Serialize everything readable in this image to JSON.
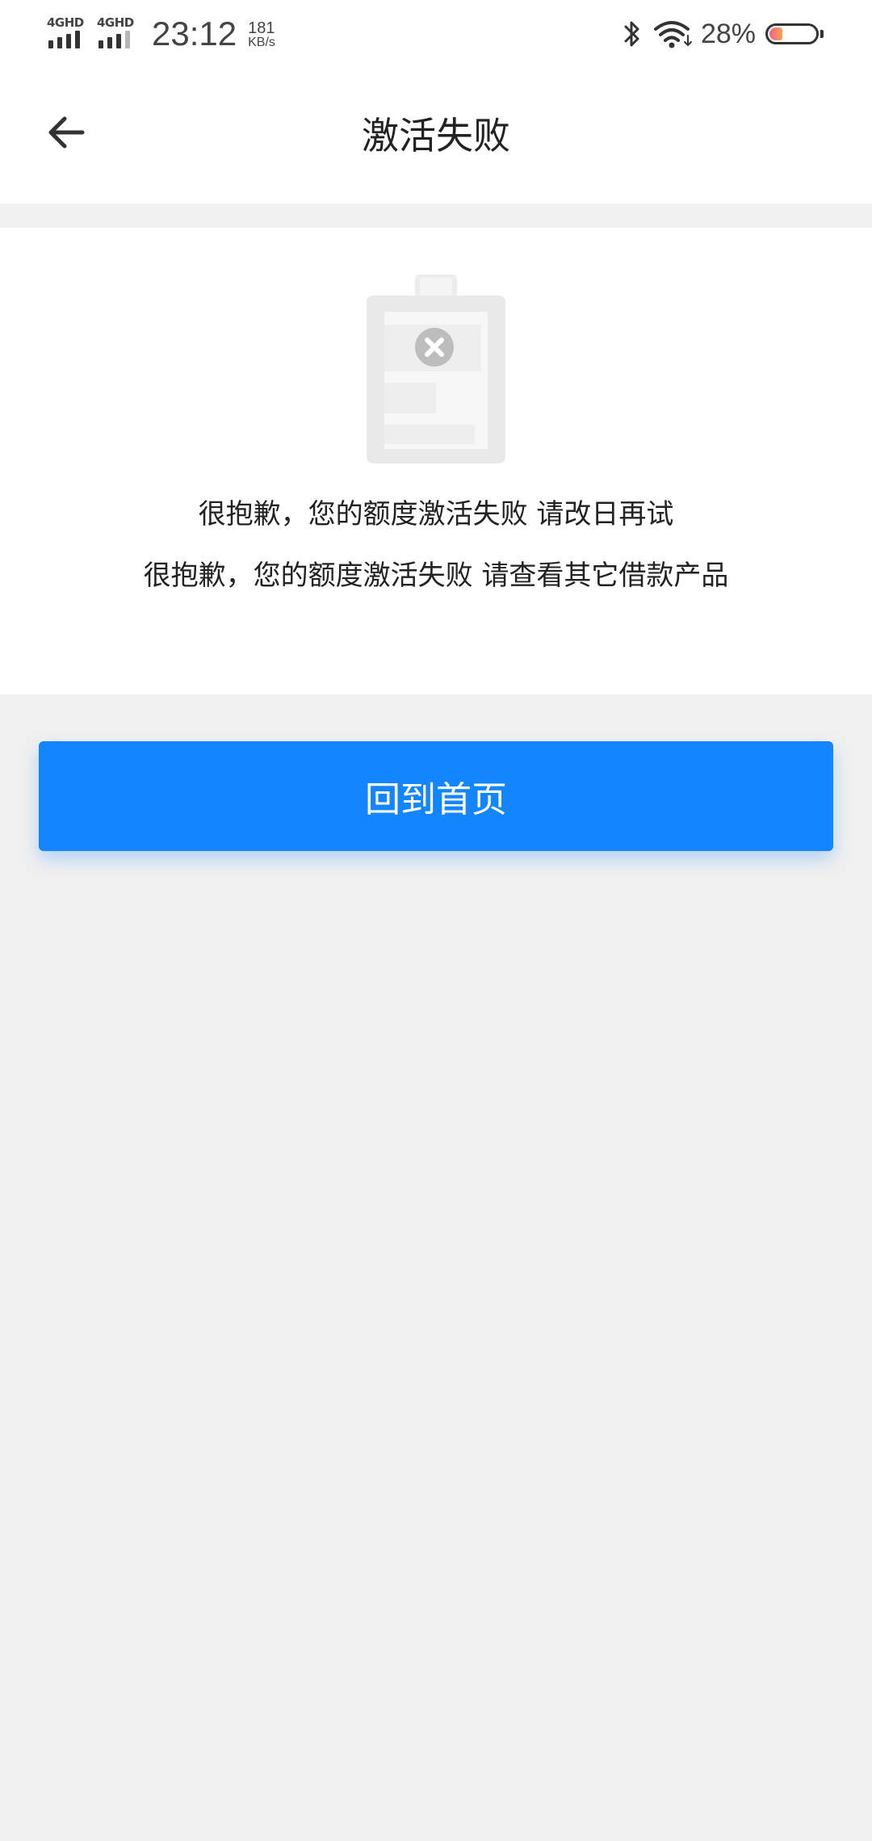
{
  "status_bar": {
    "network_1": "4GHD",
    "network_2": "4GHD",
    "time": "23:12",
    "speed_value": "181",
    "speed_unit": "KB/s",
    "bluetooth_icon": "bluetooth-icon",
    "wifi_icon": "wifi-icon",
    "battery_percent": "28%",
    "battery_level": 0.28,
    "battery_color": "#f35f8f"
  },
  "header": {
    "back_icon": "arrow-left-icon",
    "title": "激活失败"
  },
  "result": {
    "illustration_icon": "failed-clipboard-icon",
    "messages": [
      "很抱歉，您的额度激活失败 请改日再试",
      "很抱歉，您的额度激活失败 请查看其它借款产品"
    ]
  },
  "actions": {
    "home_button_label": "回到首页",
    "primary_color": "#1385ff"
  }
}
